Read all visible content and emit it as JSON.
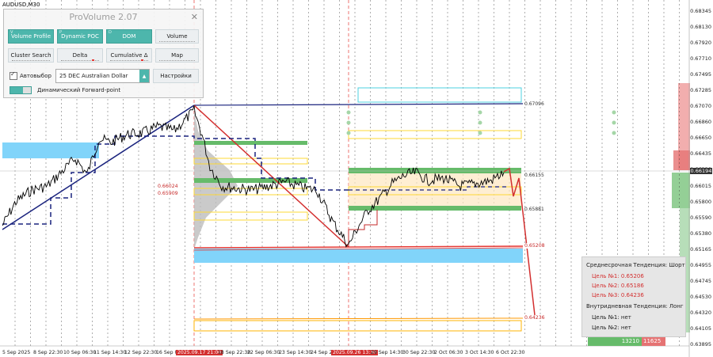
{
  "symbol": "AUDUSD,M30",
  "price_axis": [
    "0.68345",
    "0.68130",
    "0.67920",
    "0.67710",
    "0.67495",
    "0.67285",
    "0.67070",
    "0.66860",
    "0.66650",
    "0.66435",
    "0.66220",
    "0.66015",
    "0.65800",
    "0.65590",
    "0.65380",
    "0.65165",
    "0.64955",
    "0.64745",
    "0.64530",
    "0.64320",
    "0.64105",
    "0.63895"
  ],
  "current_price": "0.66194",
  "time_axis": [
    "5 Sep 2025",
    "8 Sep 22:30",
    "10 Sep 06:30",
    "11 Sep 14:30",
    "12 Sep 22:30",
    "16 Sep 06:30",
    "2025.09.17 21:00",
    "18 Sep 22:30",
    "22 Sep 06:30",
    "23 Sep 14:30",
    "24 Sep 22:30",
    "2025.09.26 13:30",
    "29 Sep 14:30",
    "30 Sep 22:30",
    "2 Oct 06:30",
    "3 Oct 14:30",
    "6 Oct 22:30"
  ],
  "level_labels": {
    "top_dashed": "0.67096",
    "upper_green": "0.66155",
    "lower_green": "0.65881",
    "red_line": "0.65208",
    "bottom_orange": "0.64236",
    "left_a": "0.66024",
    "left_b": "0.65909"
  },
  "panel": {
    "title": "ProVolume 2.07",
    "close": "✕",
    "buttons": [
      {
        "label": "Volume Profile",
        "corner": "V",
        "active": true
      },
      {
        "label": "Dynamic POC",
        "corner": "P",
        "active": true
      },
      {
        "label": "DOM",
        "corner": "D",
        "active": true
      },
      {
        "label": "Volume",
        "corner": "",
        "active": false
      },
      {
        "label": "Cluster Search",
        "corner": "",
        "active": false
      },
      {
        "label": "Delta",
        "corner": "",
        "active": false
      },
      {
        "label": "Cumulative Δ",
        "corner": "",
        "active": false
      },
      {
        "label": "Map",
        "corner": "",
        "active": false
      }
    ],
    "auto_select_label": "Автовыбор",
    "auto_select_checked": true,
    "instrument": "25 DEC Australian Dollar",
    "settings_label": "Настройки",
    "forward_point_label": "Динамический Forward-point"
  },
  "trend_box": {
    "mid_title": "Среднесрочная Тенденция: Шорт",
    "mid_targets": [
      "Цель №1: 0.65206",
      "Цель №2: 0.65186",
      "Цель №3: 0.64236"
    ],
    "intra_title": "Внутридневная Тенденция: Лонг",
    "intra_targets": [
      "Цель №1: нет",
      "Цель №2: нет"
    ]
  },
  "volume_readout": {
    "buy": "13210",
    "sell": "11625"
  },
  "colors": {
    "green": "#66bb6a",
    "red": "#e53935",
    "blue": "#1a237e",
    "teal": "#4db6ac",
    "skyblue": "#81d4fa",
    "yellow": "#fdd835",
    "orange": "#ff9800"
  }
}
